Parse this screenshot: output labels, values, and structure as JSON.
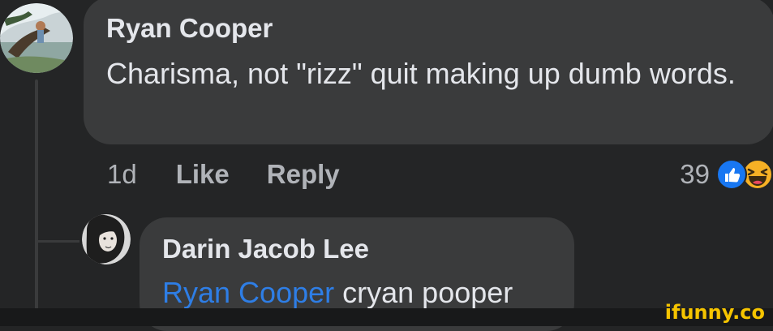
{
  "comment": {
    "author": "Ryan Cooper",
    "text": "Charisma, not \"rizz\" quit making up dumb words.",
    "time": "1d",
    "like_label": "Like",
    "reply_label": "Reply",
    "reaction_count": "39",
    "reactions": [
      "like-icon",
      "haha-icon"
    ]
  },
  "reply": {
    "author": "Darin Jacob Lee",
    "mention": "Ryan Cooper",
    "text": "cryan pooper"
  },
  "watermark": "ifunny.co",
  "colors": {
    "background": "#242526",
    "bubble": "#3a3b3c",
    "text": "#e4e6eb",
    "secondary_text": "#b0b3b8",
    "mention": "#2e7ee6",
    "like_blue": "#1877f2",
    "haha_yellow": "#f7b125",
    "watermark": "#f5c400"
  }
}
